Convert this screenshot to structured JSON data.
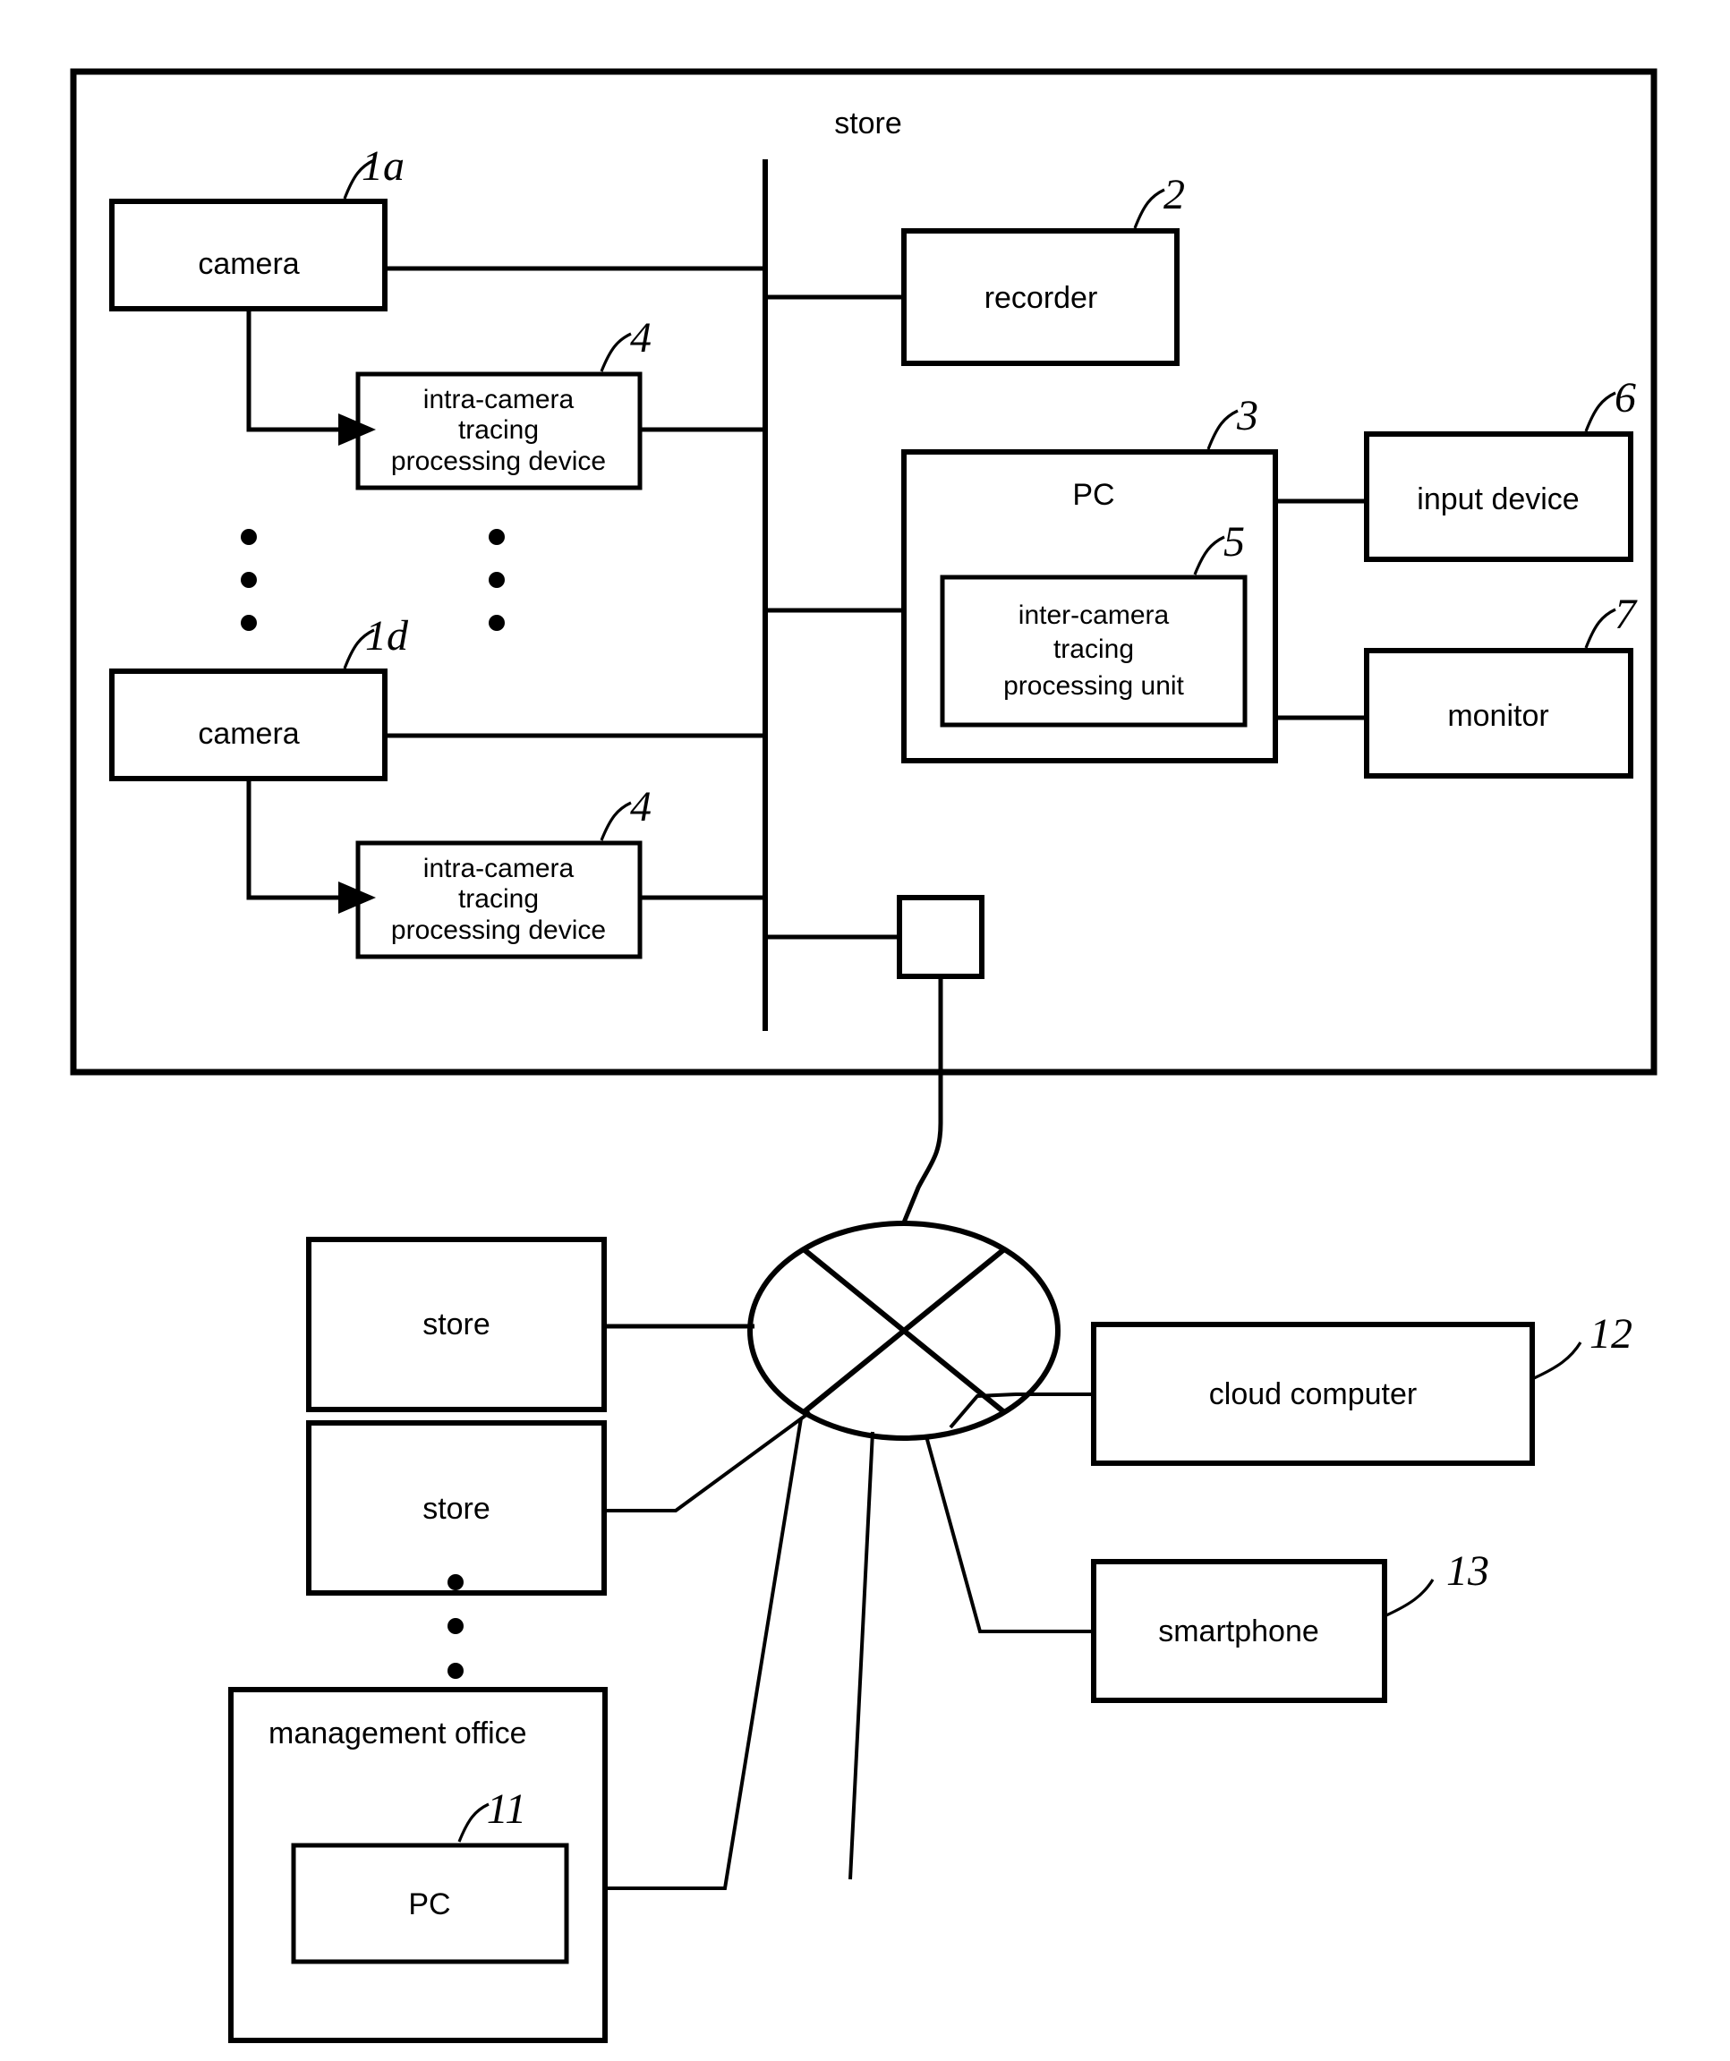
{
  "figure": {
    "title": "store",
    "store_enclosure_label": "store"
  },
  "store_section": {
    "label": "store",
    "cameras": [
      {
        "label": "camera",
        "ref": "1a"
      },
      {
        "label": "camera",
        "ref": "1d"
      }
    ],
    "intra_camera_units": [
      {
        "line1": "intra-camera",
        "line2": "tracing",
        "line3": "processing  device",
        "ref": "4"
      },
      {
        "line1": "intra-camera",
        "line2": "tracing",
        "line3": "processing  device",
        "ref": "4"
      }
    ],
    "recorder": {
      "label": "recorder",
      "ref": "2"
    },
    "pc": {
      "label": "PC",
      "ref": "3"
    },
    "inter_camera_unit": {
      "line1": "inter-camera",
      "line2": "tracing",
      "line3": "processing  unit",
      "ref": "5"
    },
    "input_device": {
      "label": "input  device",
      "ref": "6"
    },
    "monitor": {
      "label": "monitor",
      "ref": "7"
    },
    "network_connector": {
      "label": ""
    },
    "vertical_ellipsis_left": "⋮",
    "vertical_ellipsis_right": "⋮"
  },
  "network_section": {
    "cloud_node_name": "network-ellipse",
    "stores": [
      {
        "label": "store"
      },
      {
        "label": "store"
      }
    ],
    "vertical_ellipsis": "⋮",
    "management_office": {
      "label": "management  office",
      "pc": {
        "label": "PC",
        "ref": "11"
      }
    },
    "cloud_computer": {
      "label": "cloud  computer",
      "ref": "12"
    },
    "smartphone": {
      "label": "smartphone",
      "ref": "13"
    }
  },
  "colors": {
    "ink": "#000000",
    "paper": "#ffffff"
  }
}
